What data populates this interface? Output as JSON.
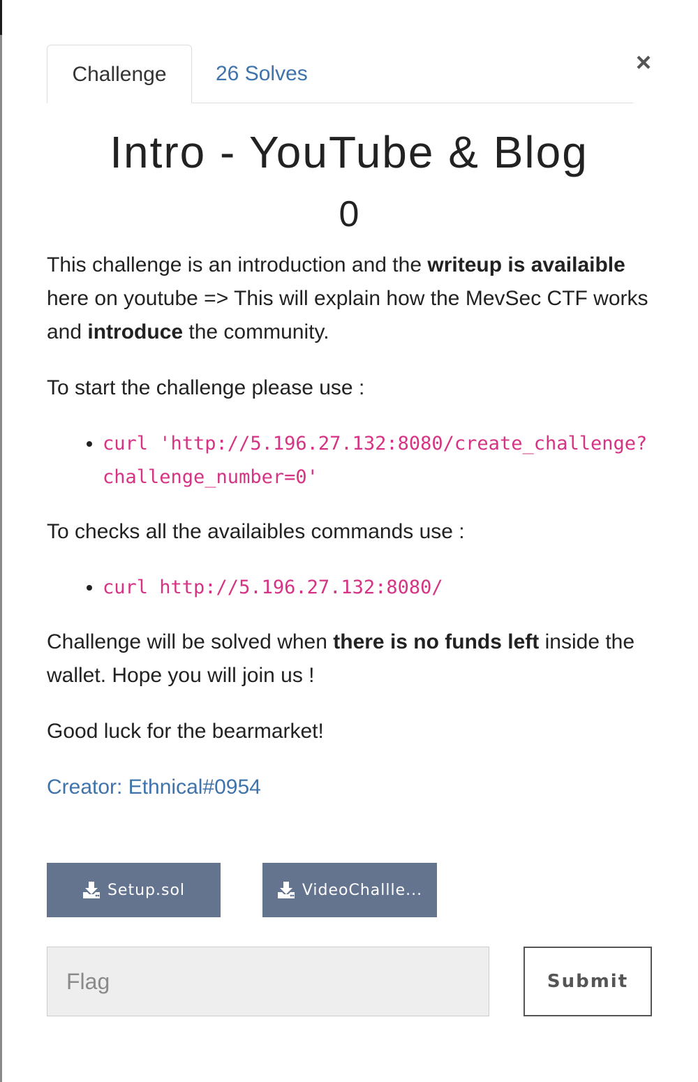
{
  "tabs": [
    {
      "label": "Challenge",
      "active": true
    },
    {
      "label": "26 Solves",
      "active": false
    }
  ],
  "close_label": "×",
  "challenge": {
    "title": "Intro - YouTube & Blog",
    "points": "0"
  },
  "description": {
    "p1": {
      "t1": "This challenge is an introduction and the ",
      "b1": "writeup is availaible",
      "t2": " here on youtube => This will explain how the MevSec CTF works and ",
      "b2": "introduce",
      "t3": " the community."
    },
    "p2": "To start the challenge please use :",
    "cmd1": "curl 'http://5.196.27.132:8080/create_challenge?challenge_number=0'",
    "p3": "To checks all the availaibles commands use :",
    "cmd2": "curl http://5.196.27.132:8080/",
    "p4": {
      "t1": "Challenge will be solved when ",
      "b1": "there is no funds left",
      "t2": " inside the wallet. Hope you will join us !"
    },
    "p5": "Good luck for the bearmarket!",
    "creator": "Creator: Ethnical#0954"
  },
  "files": [
    {
      "label": "Setup.sol",
      "icon": "download-icon"
    },
    {
      "label": "VideoChallle...",
      "icon": "download-icon"
    }
  ],
  "flag": {
    "placeholder": "Flag",
    "value": ""
  },
  "submit_label": "Submit",
  "colors": {
    "link": "#3f73ab",
    "code": "#d63384",
    "file_button": "#64748f"
  }
}
